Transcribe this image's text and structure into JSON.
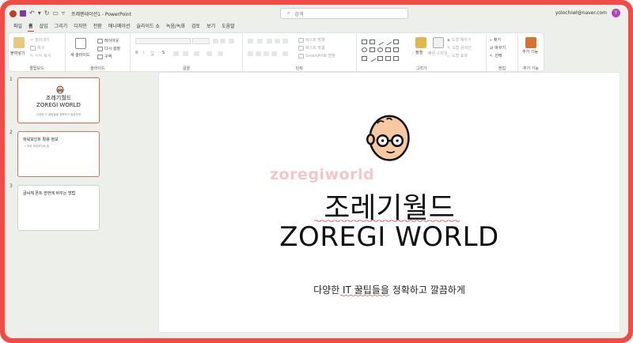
{
  "titlebar": {
    "document_title": "프레젠테이션1 - PowerPoint",
    "search_placeholder": "검색",
    "account_email": "yolochiwl@naver.com",
    "avatar_initial": "Y"
  },
  "menu": {
    "tabs": [
      "파일",
      "홈",
      "삽입",
      "그리기",
      "디자인",
      "전환",
      "애니메이션",
      "슬라이드 쇼",
      "녹음/녹화",
      "검토",
      "보기",
      "도움말"
    ],
    "active_index": 1
  },
  "ribbon": {
    "clipboard": {
      "paste": "붙여넣기",
      "cut": "잘라내기",
      "copy": "복사",
      "format_painter": "서식 복사",
      "label": "클립보드"
    },
    "slides": {
      "new_slide": "새 슬라이드",
      "layout": "레이아웃",
      "reset": "다시 설정",
      "section": "구역",
      "label": "슬라이드"
    },
    "font": {
      "font_name": "",
      "font_size": "",
      "label": "글꼴",
      "bold": "B",
      "italic": "I",
      "underline": "U",
      "strike": "S"
    },
    "paragraph": {
      "text_direction": "텍스트 방향",
      "align_text": "텍스트 맞춤",
      "smartart": "SmartArt로 변환",
      "label": "단락"
    },
    "drawing": {
      "arrange": "정렬",
      "quick_styles": "빠른 스타일",
      "shape_fill": "도형 채우기",
      "shape_outline": "도형 윤곽선",
      "shape_effects": "도형 효과",
      "label": "그리기"
    },
    "editing": {
      "find": "찾기",
      "replace": "바꾸기",
      "select": "선택",
      "label": "편집"
    },
    "addins": {
      "add_ins": "추가 기능",
      "label": "추가 기능"
    }
  },
  "thumbnails": [
    {
      "number": "1",
      "title_ko": "조레기월드",
      "title_en": "ZOREGI WORLD",
      "subtitle": "다양한 IT 꿀팁들을 정확하고 깔끔하게"
    },
    {
      "number": "2",
      "heading": "파워포인트 활용 정보",
      "bullet": "• 프로 파워포인트 팁"
    },
    {
      "number": "3",
      "heading": "글씨체 폰트 한번에 바꾸는 방법"
    }
  ],
  "slide": {
    "watermark": "zoregiworld",
    "title_ko": "조레기월드",
    "title_en": "ZOREGI WORLD",
    "subtitle": "다양한 IT 꿀팁들을 정확하고 깔끔하게"
  },
  "colors": {
    "frame": "#f44a45",
    "accent": "#c43e1c",
    "avatar": "#b83fbf",
    "face": "#f7c9a3"
  }
}
